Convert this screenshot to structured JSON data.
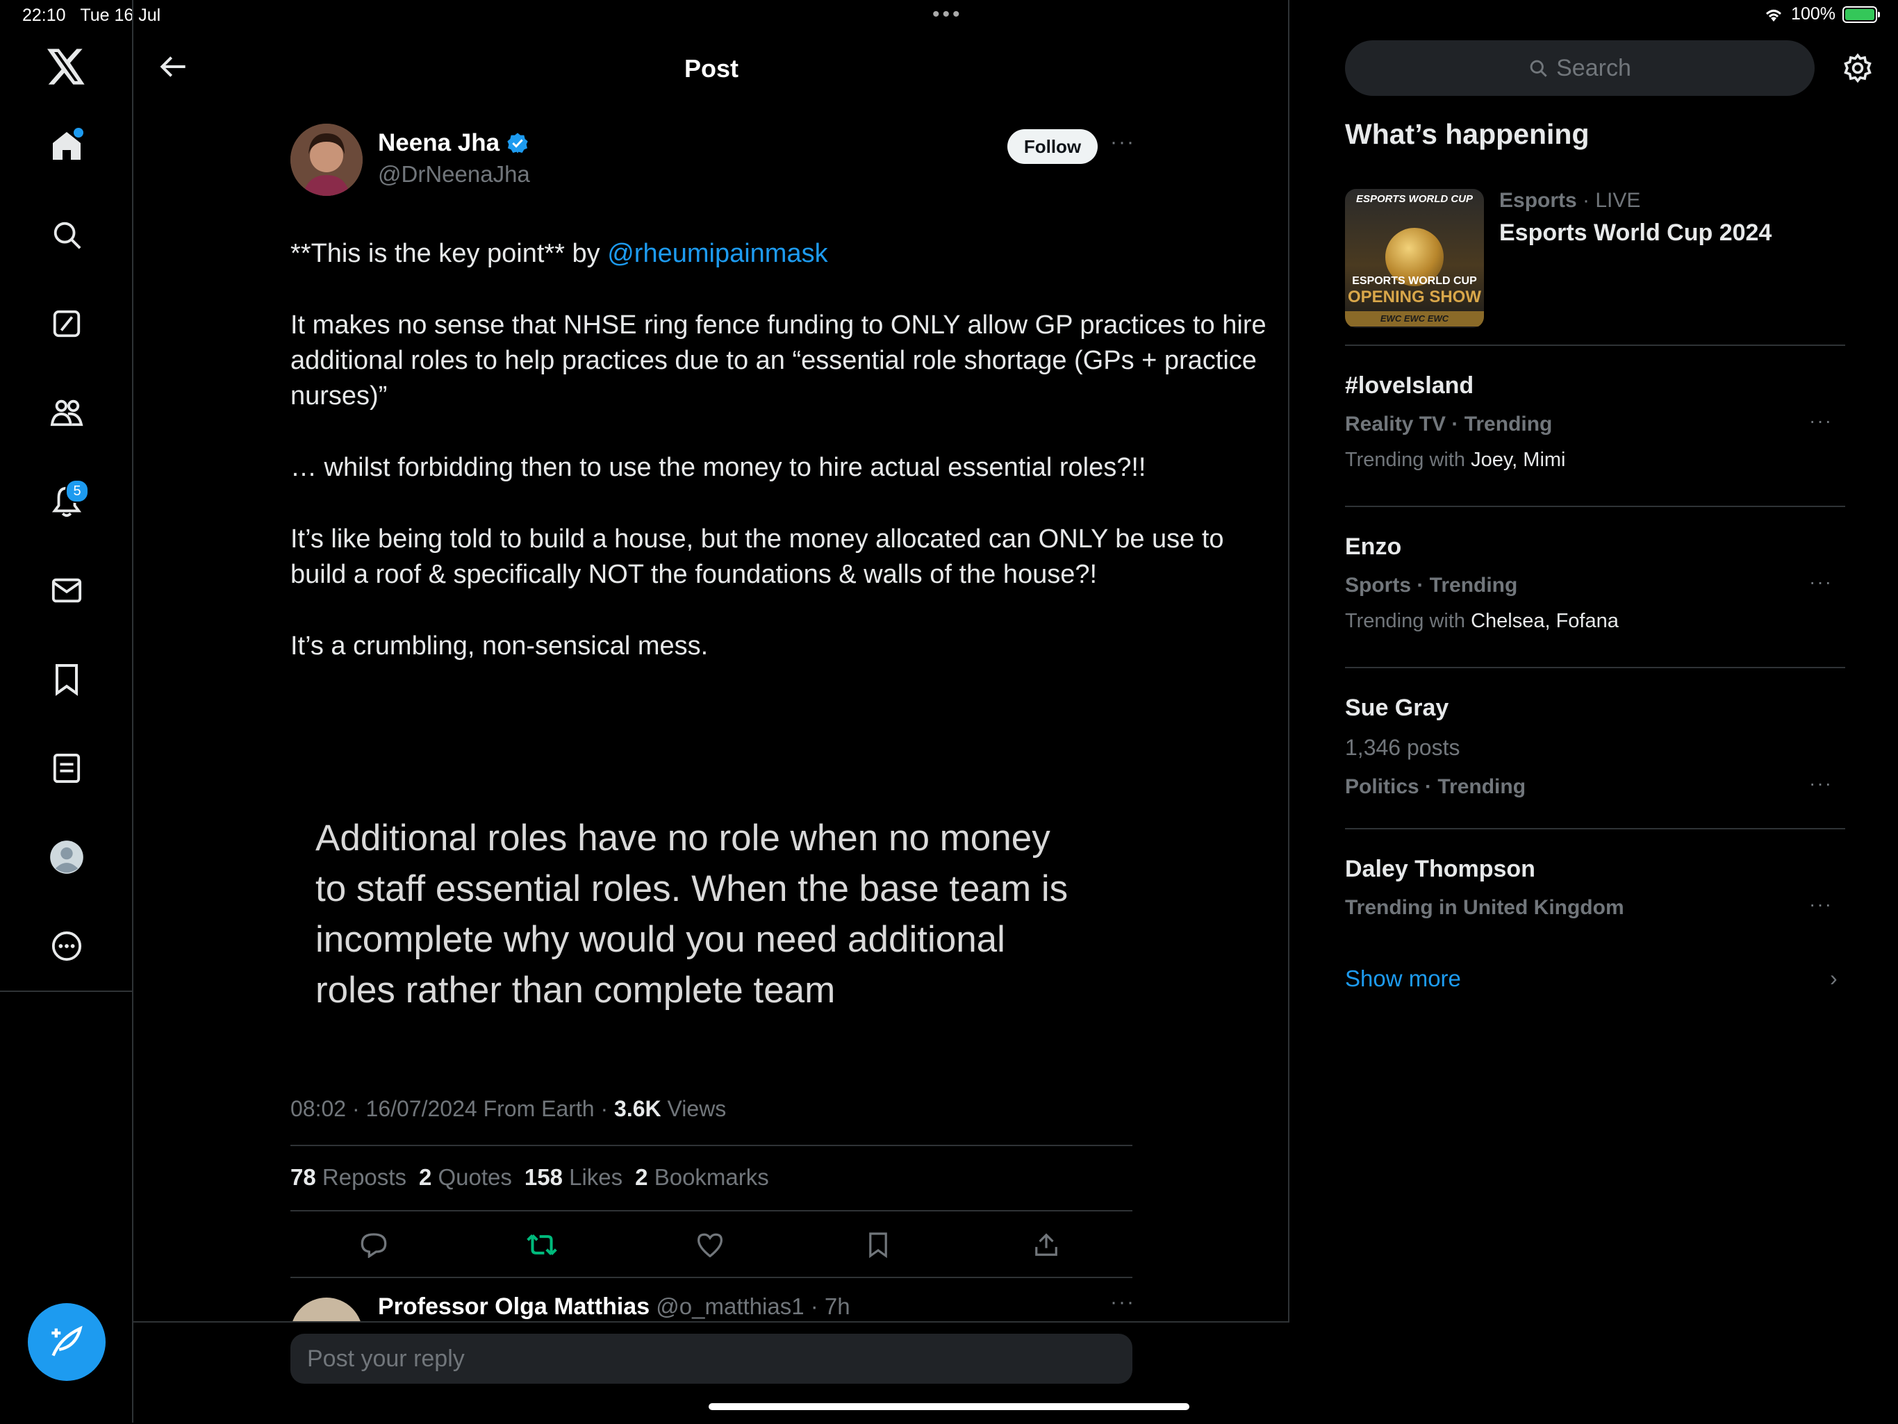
{
  "status_bar": {
    "time": "22:10",
    "date": "Tue 16 Jul",
    "dots": "•••",
    "battery": "100%"
  },
  "nav": {
    "notifications_count": "5",
    "items": [
      "x-logo-icon",
      "home-icon",
      "search-icon",
      "grok-icon",
      "communities-icon",
      "notifications-icon",
      "messages-icon",
      "bookmarks-icon",
      "lists-icon",
      "profile-icon",
      "more-icon"
    ]
  },
  "header": {
    "title": "Post"
  },
  "post": {
    "author_name": "Neena Jha",
    "author_handle": "@DrNeenaJha",
    "follow_label": "Follow",
    "more": "···",
    "line1_prefix": "**This is the key point** by ",
    "mention": "@rheumipainmask",
    "para2": "It makes no sense that NHSE ring fence funding to ONLY allow GP practices to hire additional roles to help practices due to an “essential role shortage (GPs + practice nurses)”",
    "para3": "… whilst forbidding then to use the money to hire actual essential roles?!!",
    "para4": "It’s like being told to build a house, but the money allocated can ONLY be use to build a roof & specifically NOT the foundations & walls of the house?!",
    "para5": "It’s a crumbling, non-sensical mess.",
    "quote_lines": [
      "Additional roles have no role when no money",
      "to staff essential roles. When the base team is",
      "incomplete why would you need additional",
      "roles rather than complete team"
    ],
    "meta_time": "08:02 · 16/07/2024 From Earth · ",
    "views_count": "3.6K",
    "views_label": " Views",
    "reposts_count": "78",
    "reposts_label": "Reposts",
    "quotes_count": "2",
    "quotes_label": "Quotes",
    "likes_count": "158",
    "likes_label": "Likes",
    "bookmarks_count": "2",
    "bookmarks_label": "Bookmarks"
  },
  "reply_preview": {
    "name": "Professor Olga Matthias",
    "handle_time": " @o_matthias1 · 7h",
    "more": "···"
  },
  "reply_box": {
    "placeholder": "Post your reply"
  },
  "sidebar": {
    "search_placeholder": "Search",
    "section_title": "What’s happening",
    "featured": {
      "category": "Esports",
      "live": " · LIVE",
      "title": "Esports World Cup 2024",
      "thumb_top": "ESPORTS WORLD CUP",
      "thumb_mid": "ESPORTS WORLD CUP",
      "thumb_big": "OPENING SHOW",
      "thumb_strip": "EWC  EWC  EWC"
    },
    "trends": [
      {
        "title": "#loveIsland",
        "category": "Reality TV · Trending",
        "with_label": "Trending with ",
        "with": "Joey, Mimi"
      },
      {
        "title": "Enzo",
        "category": "Sports · Trending",
        "with_label": "Trending with ",
        "with": "Chelsea, Fofana"
      },
      {
        "title": "Sue Gray",
        "count": "1,346 posts",
        "category": "Politics · Trending"
      },
      {
        "title": "Daley Thompson",
        "category": "Trending in United Kingdom"
      }
    ],
    "more": "···",
    "show_more": "Show more",
    "chevron": "›"
  },
  "colors": {
    "accent": "#1d9bf0",
    "background": "#000000",
    "muted": "#71767b",
    "repost_green": "#00ba7c"
  }
}
